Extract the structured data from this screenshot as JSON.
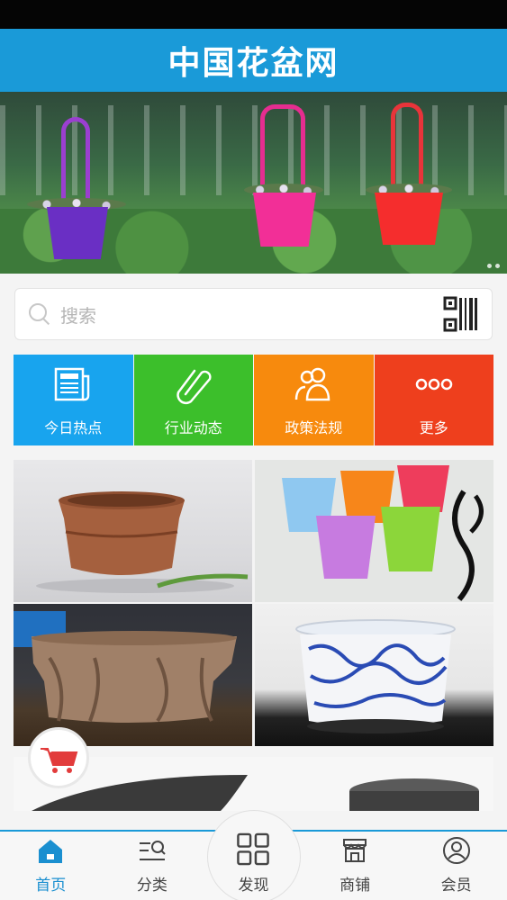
{
  "app": {
    "title": "中国花盆网"
  },
  "colors": {
    "header": "#1a9ad8",
    "active_tab": "#1a8fd0"
  },
  "banner": {
    "slide_count": 2,
    "active_slide": 1
  },
  "search": {
    "placeholder": "搜索",
    "icon": "search-icon",
    "scan_icon": "qr-code-icon"
  },
  "quick_links": [
    {
      "label": "今日热点",
      "icon": "newspaper-icon",
      "color": "#18a4ee"
    },
    {
      "label": "行业动态",
      "icon": "paperclip-icon",
      "color": "#3cbf2b"
    },
    {
      "label": "政策法规",
      "icon": "people-icon",
      "color": "#f78a0d"
    },
    {
      "label": "更多",
      "icon": "more-dots-icon",
      "color": "#ee3f1d"
    }
  ],
  "products": [
    {
      "name": "zisha-pot"
    },
    {
      "name": "plastic-pots"
    },
    {
      "name": "rootwood-pot"
    },
    {
      "name": "blue-white-porcelain-pot"
    },
    {
      "name": "dark-pots"
    }
  ],
  "cart": {
    "icon": "cart-icon"
  },
  "tabs": [
    {
      "label": "首页",
      "icon": "home-icon",
      "active": true
    },
    {
      "label": "分类",
      "icon": "category-search-icon",
      "active": false
    },
    {
      "label": "发现",
      "icon": "grid-icon",
      "active": false
    },
    {
      "label": "商铺",
      "icon": "shop-icon",
      "active": false
    },
    {
      "label": "会员",
      "icon": "user-icon",
      "active": false
    }
  ]
}
